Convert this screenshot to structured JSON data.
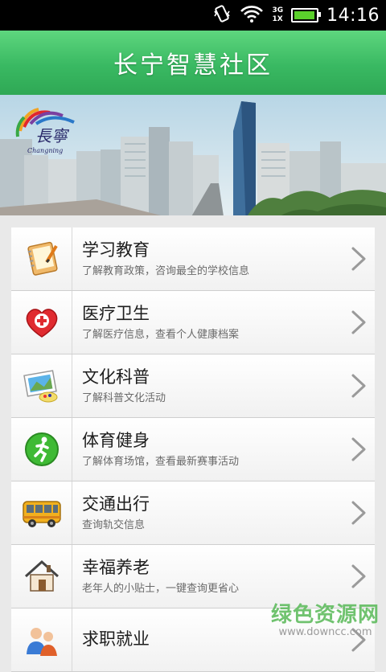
{
  "status_bar": {
    "time": "14:16",
    "network_top": "3G",
    "network_bottom": "1X",
    "battery_level": 0.9,
    "icons": [
      "vibrate-icon",
      "wifi-icon",
      "signal-icon",
      "battery-icon"
    ]
  },
  "header": {
    "title": "长宁智慧社区"
  },
  "banner": {
    "logo_text": "長寧",
    "logo_subtext": "Changning"
  },
  "menu": {
    "items": [
      {
        "title": "学习教育",
        "desc": "了解教育政策，咨询最全的学校信息",
        "icon": "notebook-icon"
      },
      {
        "title": "医疗卫生",
        "desc": "了解医疗信息，查看个人健康档案",
        "icon": "medical-heart-icon"
      },
      {
        "title": "文化科普",
        "desc": "了解科普文化活动",
        "icon": "picture-palette-icon"
      },
      {
        "title": "体育健身",
        "desc": "了解体育场馆，查看最新赛事活动",
        "icon": "runner-icon"
      },
      {
        "title": "交通出行",
        "desc": "查询轨交信息",
        "icon": "bus-icon"
      },
      {
        "title": "幸福养老",
        "desc": "老年人的小贴士，一键查询更省心",
        "icon": "house-icon"
      },
      {
        "title": "求职就业",
        "desc": "",
        "icon": "people-icon"
      }
    ]
  },
  "watermark": {
    "main": "绿色资源网",
    "sub": "www.downcc.com"
  },
  "colors": {
    "header_green": "#39b962",
    "accent_red": "#d9232a"
  }
}
